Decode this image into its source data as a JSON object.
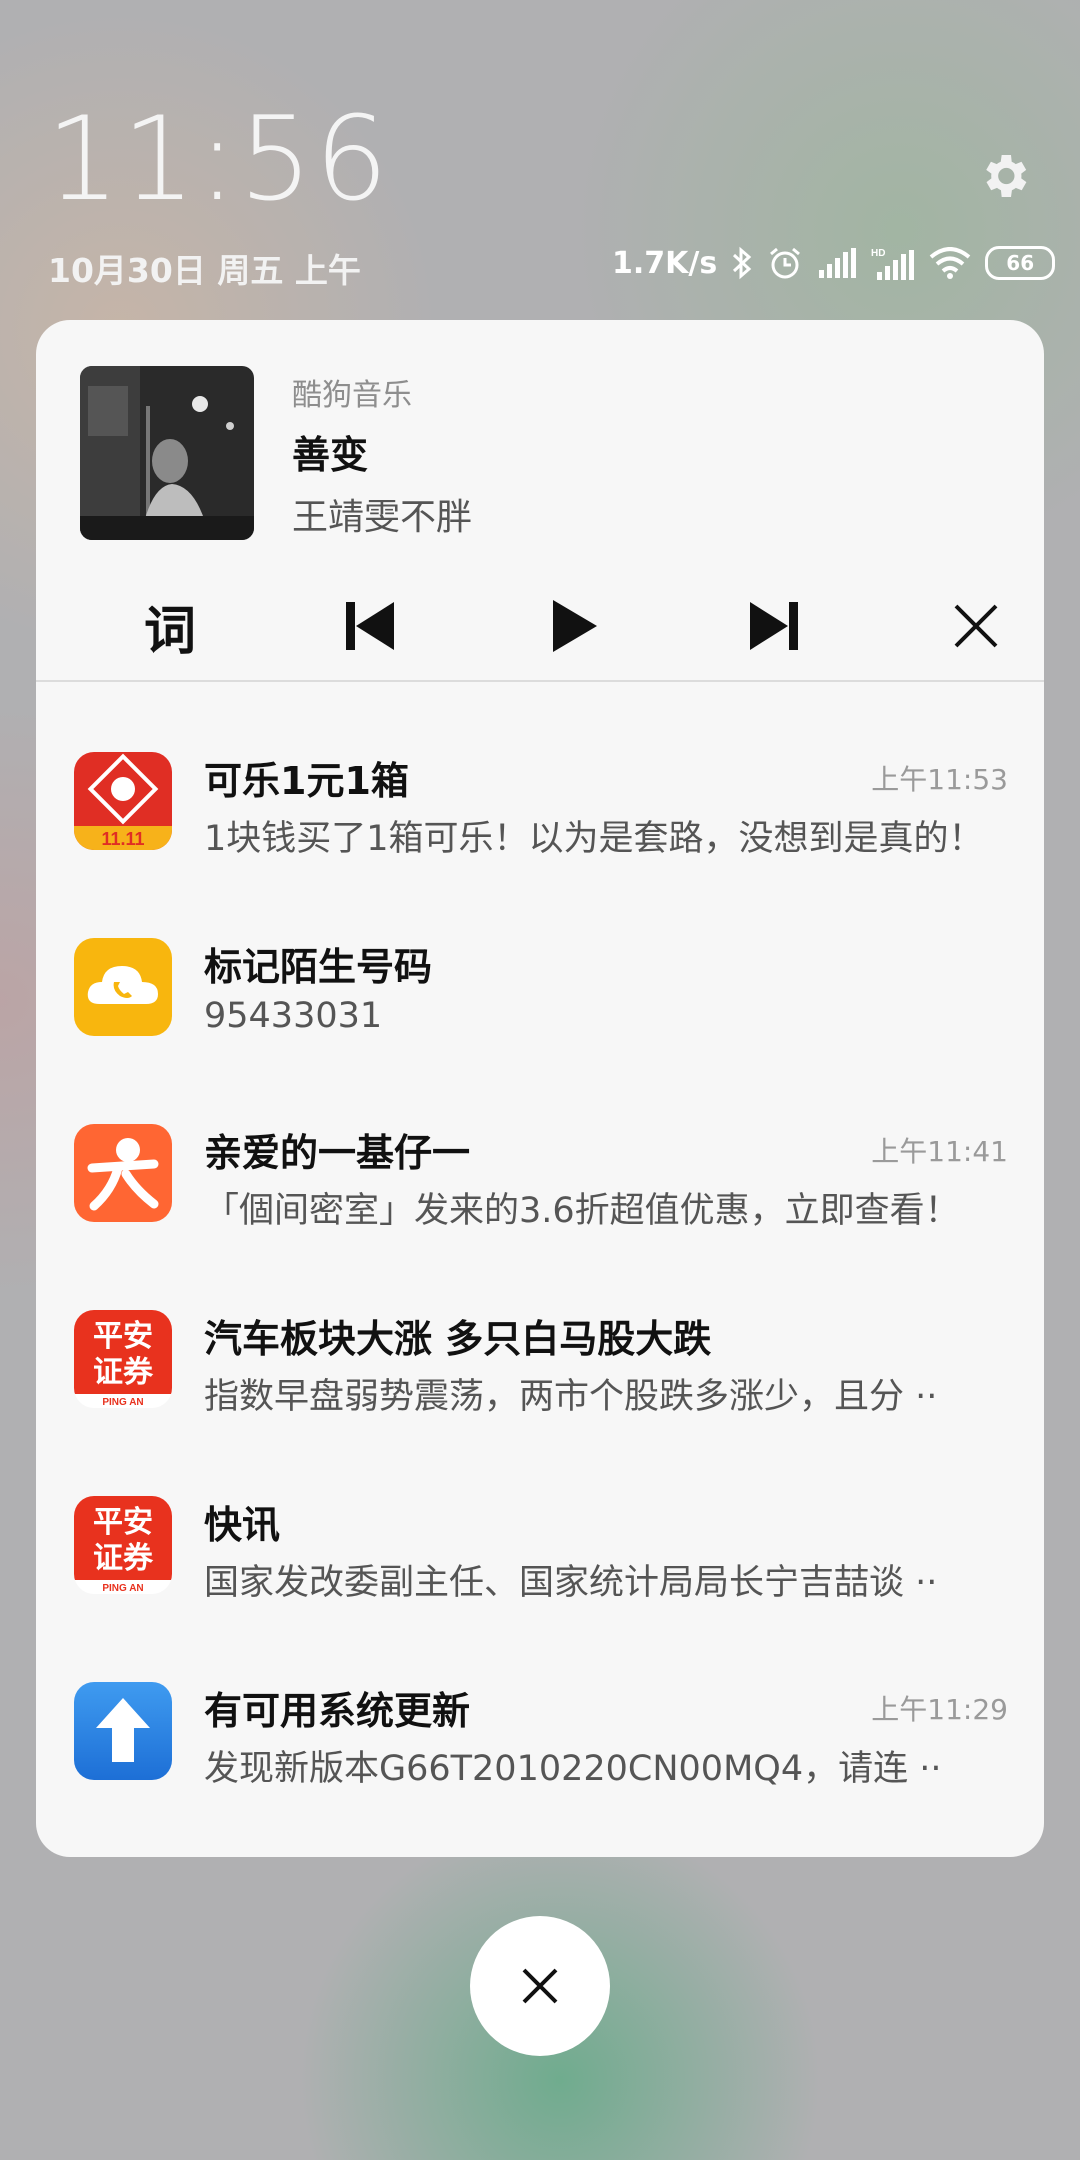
{
  "status": {
    "time": "11:56",
    "date": "10月30日 周五 上午",
    "net_speed": "1.7K/s",
    "battery": "66",
    "icons": [
      "bluetooth-icon",
      "alarm-icon",
      "signal-icon",
      "hd-signal-icon",
      "wifi-icon",
      "battery-icon",
      "gear-icon"
    ]
  },
  "music": {
    "app_name": "酷狗音乐",
    "song": "善变",
    "artist": "王靖雯不胖",
    "lyric_label": "词",
    "controls": [
      "lyrics-button",
      "previous-icon",
      "play-icon",
      "next-icon",
      "close-icon"
    ]
  },
  "notifications": [
    {
      "icon": "pinduoduo-icon",
      "title": "可乐1元1箱",
      "text": "1块钱买了1箱可乐！以为是套路，没想到是真的！",
      "time": "上午11:53",
      "icon_badge": "11.11"
    },
    {
      "icon": "cloud-phone-icon",
      "title": "标记陌生号码",
      "text": "95433031",
      "time": ""
    },
    {
      "icon": "dianping-icon",
      "title": "亲爱的一基仔一",
      "text": "「個间密室」发来的3.6折超值优惠，立即查看！",
      "time": "上午11:41"
    },
    {
      "icon": "pingan-icon",
      "title": "汽车板块大涨 多只白马股大跌",
      "text": "指数早盘弱势震荡，两市个股跌多涨少，且分 ··",
      "time": "",
      "icon_text_top": "平安",
      "icon_text_bottom": "证券",
      "icon_footer": "PING AN"
    },
    {
      "icon": "pingan-icon",
      "title": "快讯",
      "text": "国家发改委副主任、国家统计局局长宁吉喆谈 ··",
      "time": "",
      "icon_text_top": "平安",
      "icon_text_bottom": "证券",
      "icon_footer": "PING AN"
    },
    {
      "icon": "system-update-icon",
      "title": "有可用系统更新",
      "text": "发现新版本G66T2010220CN00MQ4，请连 ··",
      "time": "上午11:29"
    }
  ],
  "colors": {
    "pinduoduo": "#e02e24",
    "cloud": "#f8b60e",
    "dianping": "#ff6633",
    "pingan": "#e8321e",
    "update": "#2a7fe0"
  }
}
